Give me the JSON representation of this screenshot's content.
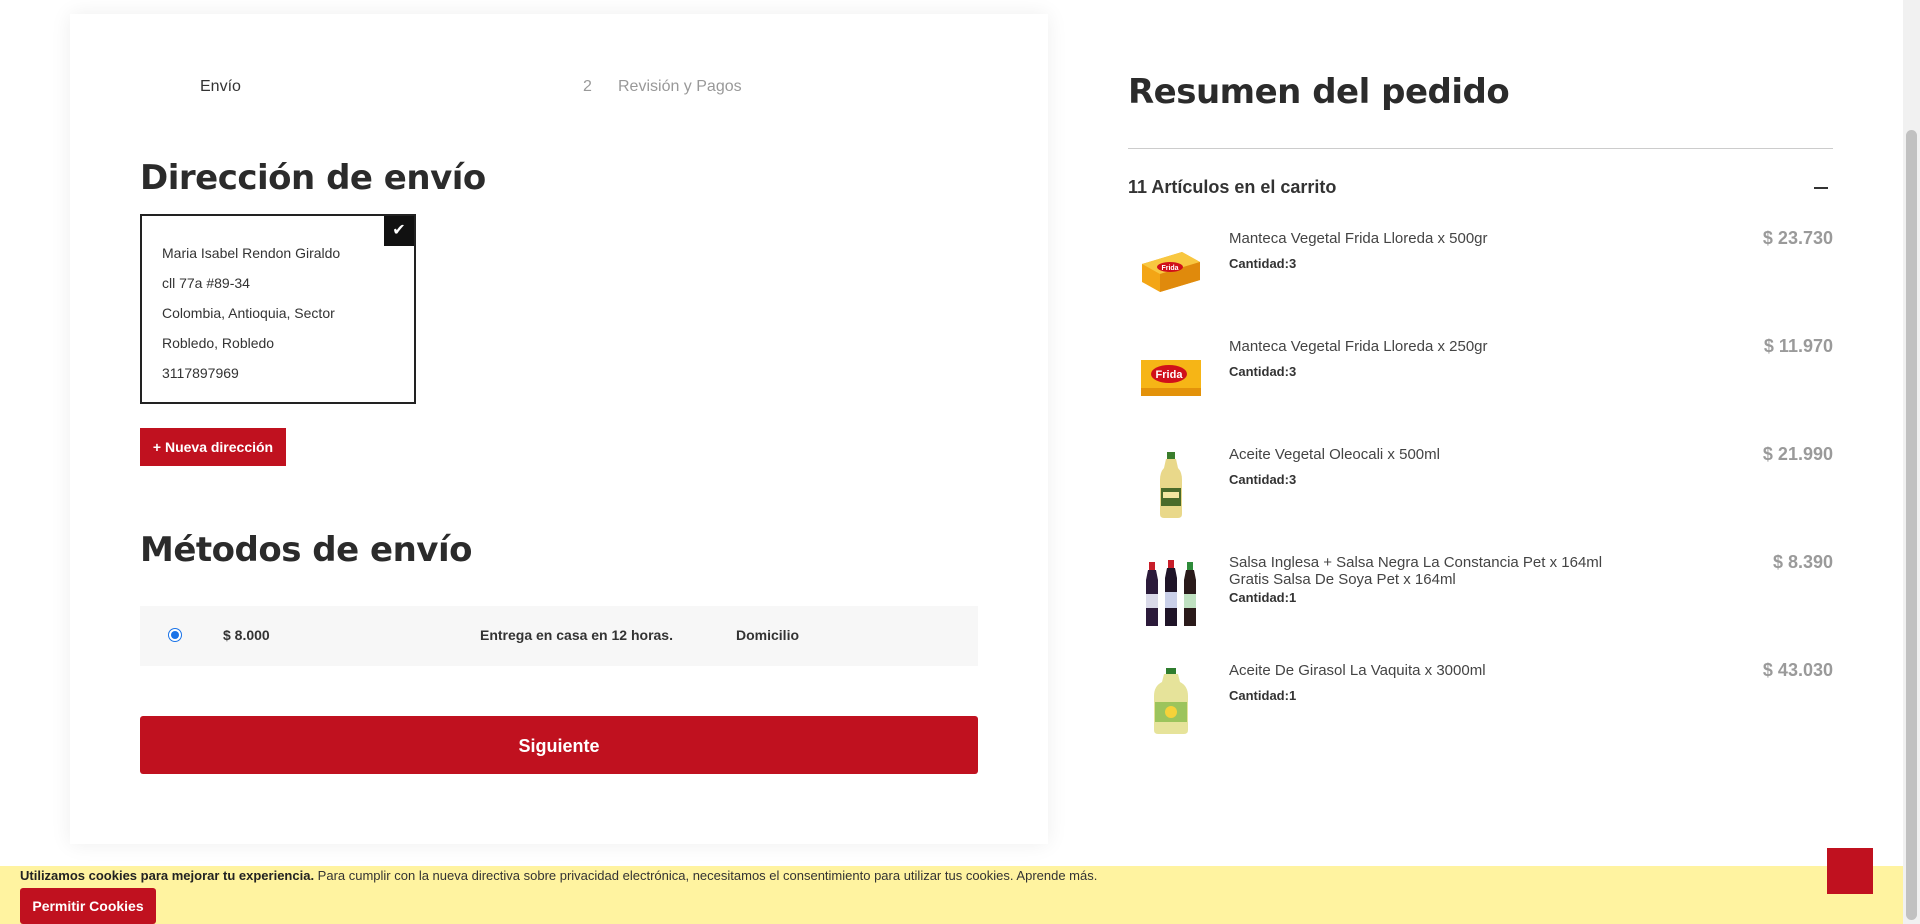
{
  "steps": {
    "step1_label": "Envío",
    "step2_number": "2",
    "step2_label": "Revisión y Pagos"
  },
  "shipping_address": {
    "title": "Dirección de envío",
    "lines": [
      "Maria Isabel Rendon Giraldo",
      "cll 77a #89-34",
      "Colombia, Antioquia, Sector",
      "Robledo, Robledo",
      "3117897969"
    ],
    "selected_icon": "checkmark-icon",
    "new_address_label": "+ Nueva dirección"
  },
  "shipping_methods": {
    "title": "Métodos de envío",
    "options": [
      {
        "price": "$ 8.000",
        "description": "Entrega en casa en 12 horas.",
        "type": "Domicilio",
        "selected": true
      }
    ],
    "next_label": "Siguiente"
  },
  "summary": {
    "title": "Resumen del pedido",
    "cart_count_label": "11 Artículos en el carrito",
    "collapse_icon": "minus-icon",
    "items": [
      {
        "name": "Manteca Vegetal Frida Lloreda x 500gr",
        "qty": "Cantidad:3",
        "price": "$ 23.730",
        "thumb": "frida-500gr-package-icon"
      },
      {
        "name": "Manteca Vegetal Frida Lloreda x 250gr",
        "qty": "Cantidad:3",
        "price": "$ 11.970",
        "thumb": "frida-250gr-package-icon"
      },
      {
        "name": "Aceite Vegetal Oleocali x 500ml",
        "qty": "Cantidad:3",
        "price": "$ 21.990",
        "thumb": "oil-bottle-icon"
      },
      {
        "name": "Salsa Inglesa + Salsa Negra La Constancia Pet x 164ml Gratis Salsa De Soya Pet x 164ml",
        "qty": "Cantidad:1",
        "price": "$ 8.390",
        "thumb": "sauce-bottles-icon"
      },
      {
        "name": "Aceite De Girasol La Vaquita x 3000ml",
        "qty": "Cantidad:1",
        "price": "$ 43.030",
        "thumb": "large-oil-bottle-icon"
      }
    ]
  },
  "cookie_banner": {
    "bold_text": "Utilizamos cookies para mejorar tu experiencia.",
    "text": " Para cumplir con la nueva directiva sobre privacidad electrónica, necesitamos el consentimiento para utilizar tus cookies. ",
    "link": "Aprende más.",
    "button_label": "Permitir Cookies"
  },
  "colors": {
    "brand_red": "#c0111f",
    "cookie_bg": "#fff3a0",
    "radio_blue": "#1a73e8"
  }
}
